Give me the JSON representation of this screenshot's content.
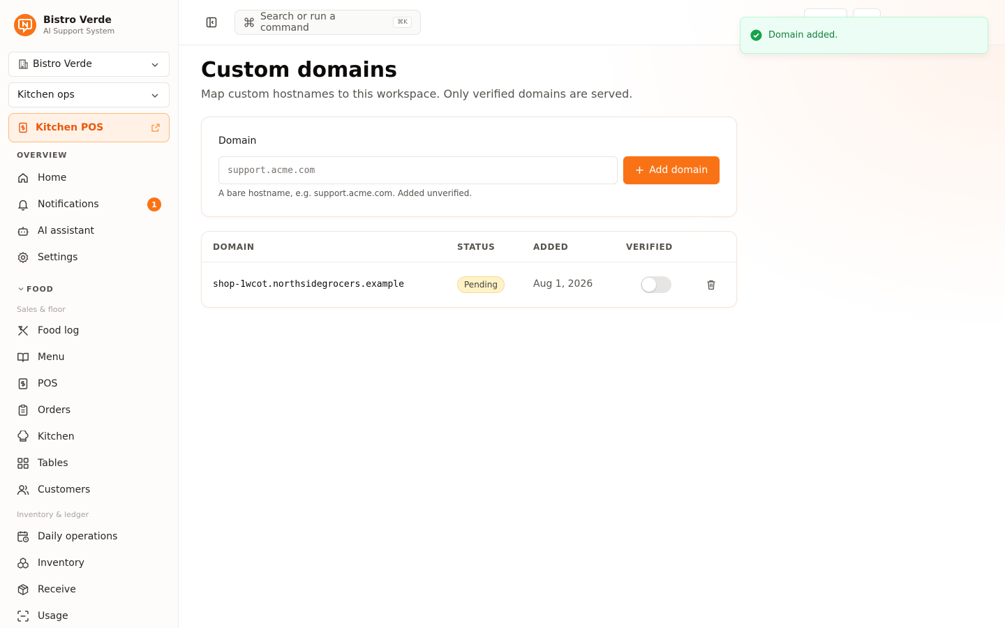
{
  "brand": {
    "name": "Bistro Verde",
    "subtitle": "AI Support System"
  },
  "org_select": {
    "value": "Bistro Verde"
  },
  "team_select": {
    "value": "Kitchen ops"
  },
  "pos_link": {
    "label": "Kitchen POS"
  },
  "nav": {
    "overview_label": "OVERVIEW",
    "overview": [
      {
        "label": "Home",
        "icon": "home-icon"
      },
      {
        "label": "Notifications",
        "icon": "bell-icon",
        "badge": "1"
      },
      {
        "label": "AI assistant",
        "icon": "bot-icon"
      },
      {
        "label": "Settings",
        "icon": "gear-icon"
      }
    ],
    "food_label": "FOOD",
    "sales_label": "Sales & floor",
    "sales": [
      {
        "label": "Food log",
        "icon": "utensils-icon"
      },
      {
        "label": "Menu",
        "icon": "book-icon"
      },
      {
        "label": "POS",
        "icon": "receipt-icon"
      },
      {
        "label": "Orders",
        "icon": "clipboard-icon"
      },
      {
        "label": "Kitchen",
        "icon": "chef-hat-icon"
      },
      {
        "label": "Tables",
        "icon": "grid-icon"
      },
      {
        "label": "Customers",
        "icon": "users-icon"
      }
    ],
    "inventory_label": "Inventory & ledger",
    "inventory": [
      {
        "label": "Daily operations",
        "icon": "calendar-clock-icon"
      },
      {
        "label": "Inventory",
        "icon": "boxes-icon"
      },
      {
        "label": "Receive",
        "icon": "package-icon"
      },
      {
        "label": "Usage",
        "icon": "scan-icon"
      }
    ]
  },
  "topbar": {
    "search_placeholder": "Search or run a command",
    "search_shortcut": "⌘K"
  },
  "page": {
    "title": "Custom domains",
    "subtitle": "Map custom hostnames to this workspace. Only verified domains are served."
  },
  "form": {
    "label": "Domain",
    "placeholder": "support.acme.com",
    "button": "Add domain",
    "hint": "A bare hostname, e.g. support.acme.com. Added unverified."
  },
  "table": {
    "columns": [
      "DOMAIN",
      "STATUS",
      "ADDED",
      "VERIFIED"
    ],
    "rows": [
      {
        "domain": "shop-1wcot.northsidegrocers.example",
        "status": "Pending",
        "added": "Aug 1, 2026",
        "verified": false
      }
    ]
  },
  "toast": {
    "message": "Domain added."
  },
  "colors": {
    "accent": "#f97316",
    "success": "#16a34a",
    "pending_bg": "#fef3c7"
  }
}
